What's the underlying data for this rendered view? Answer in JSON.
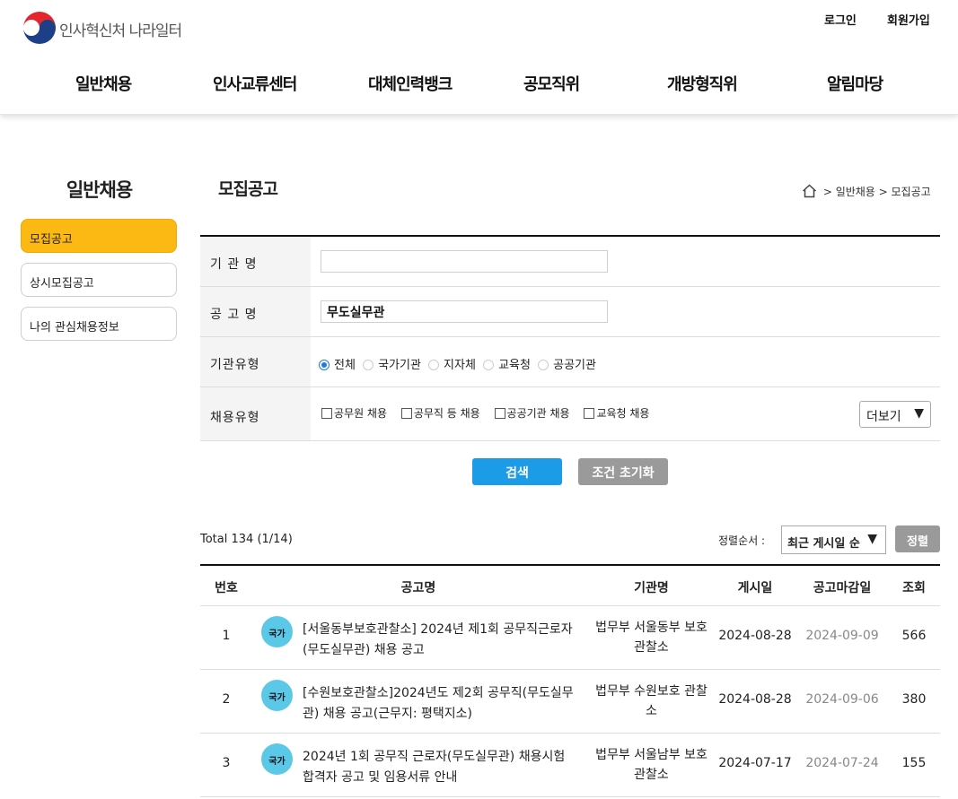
{
  "header": {
    "logo_text": "인사혁신처 나라일터",
    "util": [
      "로그인",
      "회원가입"
    ],
    "gnb": [
      "일반채용",
      "인사교류센터",
      "대체인력뱅크",
      "공모직위",
      "개방형직위",
      "알림마당"
    ]
  },
  "sidebar": {
    "title": "일반채용",
    "items": [
      {
        "label": "모집공고",
        "active": true
      },
      {
        "label": "상시모집공고",
        "active": false
      },
      {
        "label": "나의 관심채용정보",
        "active": false
      }
    ]
  },
  "page": {
    "title": "모집공고",
    "breadcrumb": [
      "일반채용",
      "모집공고"
    ]
  },
  "search_form": {
    "org_label": "기 관 명",
    "org_value": "",
    "notice_label": "공 고 명",
    "notice_value": "무도실무관",
    "org_type_label": "기관유형",
    "org_types": [
      "전체",
      "국가기관",
      "지자체",
      "교육청",
      "공공기관"
    ],
    "org_type_selected": "전체",
    "hire_type_label": "채용유형",
    "hire_types": [
      "공무원 채용",
      "공무직 등 채용",
      "공공기관 채용",
      "교육청 채용"
    ],
    "more_label": "더보기",
    "search_button": "검색",
    "reset_button": "조건 초기화"
  },
  "list": {
    "total": "Total 134 (1/14)",
    "sort_label": "정렬순서 :",
    "sort_value": "최근 게시일 순",
    "sort_button": "정렬",
    "columns": [
      "번호",
      "공고명",
      "기관명",
      "게시일",
      "공고마감일",
      "조회"
    ],
    "rows": [
      {
        "no": "1",
        "badge": "국가",
        "title": "[서울동부보호관찰소] 2024년 제1회 공무직근로자 (무도실무관) 채용 공고",
        "org": "법무부 서울동부 보호관찰소",
        "posted": "2024-08-28",
        "deadline": "2024-09-09",
        "views": "566"
      },
      {
        "no": "2",
        "badge": "국가",
        "title": "[수원보호관찰소]2024년도 제2회 공무직(무도실무관) 채용 공고(근무지: 평택지소)",
        "org": "법무부 수원보호 관찰소",
        "posted": "2024-08-28",
        "deadline": "2024-09-06",
        "views": "380"
      },
      {
        "no": "3",
        "badge": "국가",
        "title": "2024년 1회 공무직 근로자(무도실무관) 채용시험 합격자 공고 및 임용서류 안내",
        "org": "법무부 서울남부 보호관찰소",
        "posted": "2024-07-17",
        "deadline": "2024-07-24",
        "views": "155"
      }
    ]
  },
  "colors": {
    "accent_yellow": "#fdb913",
    "search_blue": "#1c9be6",
    "reset_gray": "#9a9a9a",
    "badge_blue": "#5bc8e8"
  }
}
